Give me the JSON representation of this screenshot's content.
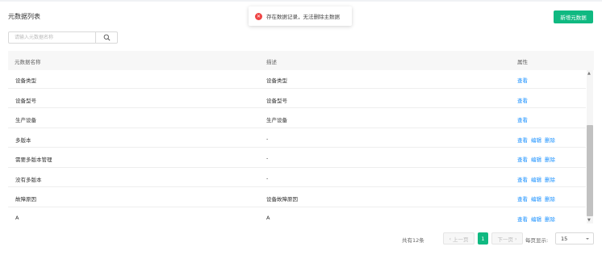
{
  "header": {
    "title": "元数据列表",
    "add_label": "新增元数据"
  },
  "search": {
    "placeholder": "请输入元数据名称",
    "value": ""
  },
  "toast": {
    "message": "存在数据记录，无法删除主数据",
    "icon": "close-circle-icon",
    "color": "#ef4444"
  },
  "table": {
    "columns": [
      "元数据名称",
      "描述",
      "属性"
    ],
    "rows": [
      {
        "name": "设备类型",
        "desc": "设备类型",
        "actions": [
          "查看"
        ]
      },
      {
        "name": "设备型号",
        "desc": "设备型号",
        "actions": [
          "查看"
        ]
      },
      {
        "name": "生产设备",
        "desc": "生产设备",
        "actions": [
          "查看"
        ]
      },
      {
        "name": "多版本",
        "desc": "-",
        "actions": [
          "查看",
          "编辑",
          "删除"
        ]
      },
      {
        "name": "需要多版本管理",
        "desc": "-",
        "actions": [
          "查看",
          "编辑",
          "删除"
        ]
      },
      {
        "name": "没有多版本",
        "desc": "-",
        "actions": [
          "查看",
          "编辑",
          "删除"
        ]
      },
      {
        "name": "故障原因",
        "desc": "设备故障原因",
        "actions": [
          "查看",
          "编辑",
          "删除"
        ]
      },
      {
        "name": "A",
        "desc": "A",
        "actions": [
          "查看",
          "编辑",
          "删除"
        ]
      }
    ]
  },
  "pagination": {
    "total": "共有12条",
    "prev": "上一页",
    "next": "下一页",
    "current": "1",
    "per_page_label": "每页显示:",
    "per_page": "15"
  },
  "colors": {
    "accent": "#10b981",
    "link": "#1890ff"
  }
}
